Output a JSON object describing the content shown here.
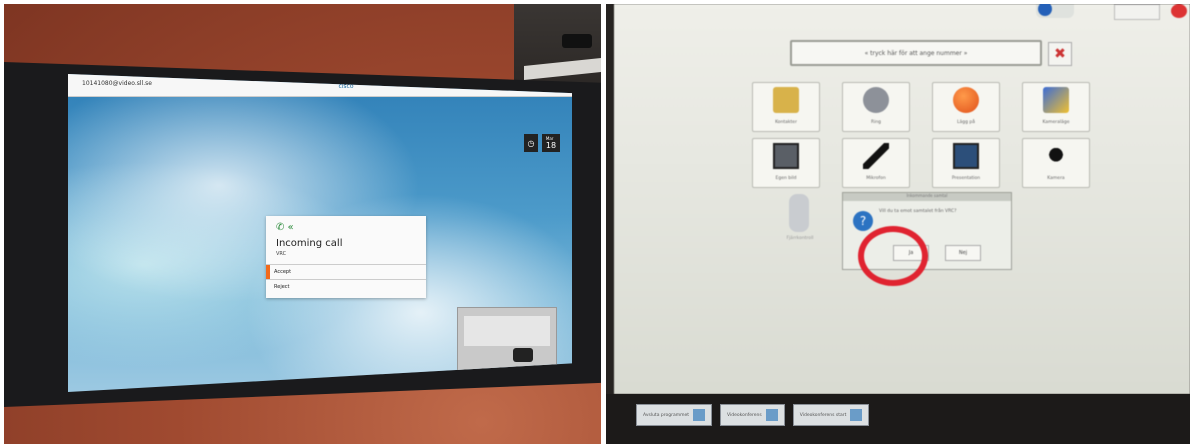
{
  "left_photo": {
    "address": "10141080@video.sll.se",
    "brand": "cisco",
    "clock_icon": "clock-icon",
    "date_month": "Mar",
    "date_day": "18",
    "call": {
      "title": "Incoming call",
      "caller": "VRC",
      "accept": "Accept",
      "reject": "Reject"
    }
  },
  "right_photo": {
    "number_field": "« tryck här för att ange nummer »",
    "tiles_row1": [
      {
        "label": "Kontakter",
        "icon": "contacts-icon"
      },
      {
        "label": "Ring",
        "icon": "call-icon"
      },
      {
        "label": "Lägg på",
        "icon": "hangup-icon"
      },
      {
        "label": "Kameraläge",
        "icon": "camera-mode-icon"
      }
    ],
    "tiles_row2": [
      {
        "label": "Egen bild",
        "icon": "selfview-icon"
      },
      {
        "label": "Mikrofon",
        "icon": "microphone-icon"
      },
      {
        "label": "Presentation",
        "icon": "presentation-icon"
      },
      {
        "label": "Kamera",
        "icon": "camera-icon"
      }
    ],
    "remote_label": "Fjärrkontroll",
    "dialog": {
      "title": "Inkommande samtal",
      "message": "Vill du ta emot samtalet från VRC?",
      "yes": "Ja",
      "no": "Nej"
    },
    "taskbar": [
      "Avsluta programmet",
      "Videokonferens",
      "Videokonferens start"
    ]
  }
}
